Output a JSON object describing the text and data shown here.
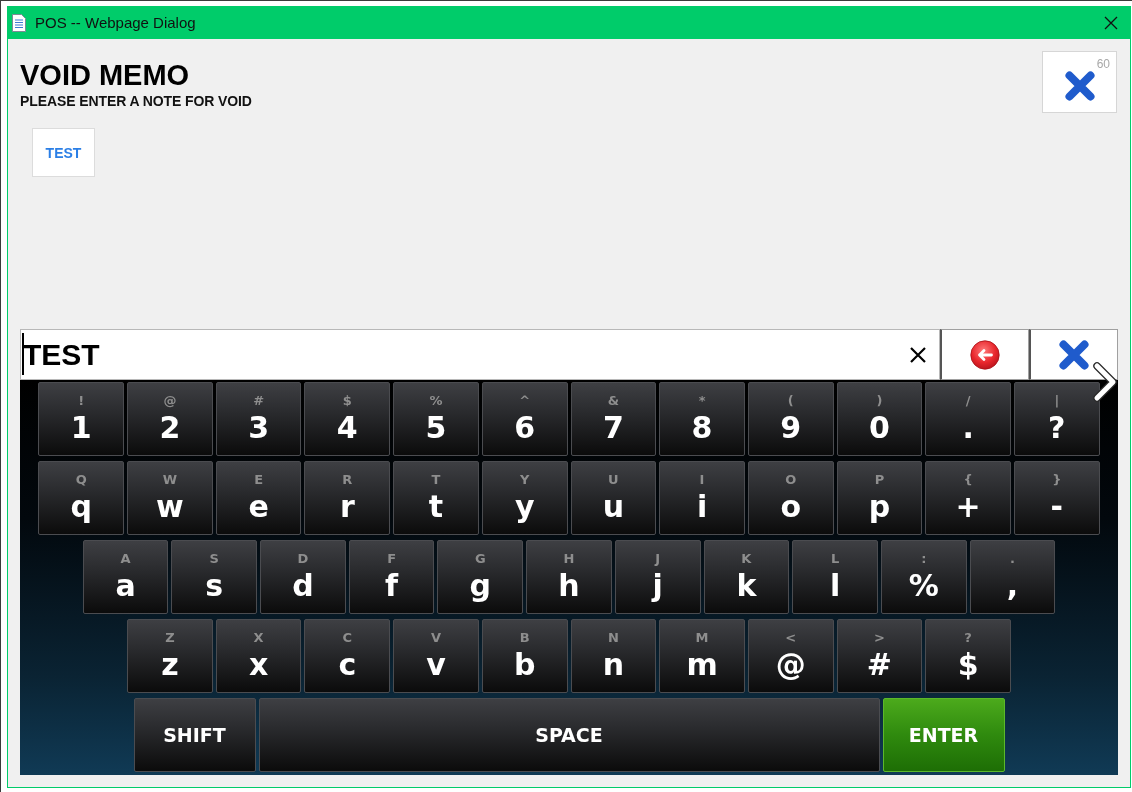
{
  "window": {
    "title": "POS -- Webpage Dialog"
  },
  "header": {
    "title": "VOID MEMO",
    "subtitle": "PLEASE ENTER A NOTE FOR VOID"
  },
  "close_button": {
    "countdown": "60"
  },
  "quick_notes": [
    {
      "label": "TEST"
    }
  ],
  "input": {
    "value": "TEST"
  },
  "keyboard": {
    "rows": [
      {
        "keys": [
          {
            "kind": "char",
            "shift": "!",
            "label": "1"
          },
          {
            "kind": "char",
            "shift": "@",
            "label": "2"
          },
          {
            "kind": "char",
            "shift": "#",
            "label": "3"
          },
          {
            "kind": "char",
            "shift": "$",
            "label": "4"
          },
          {
            "kind": "char",
            "shift": "%",
            "label": "5"
          },
          {
            "kind": "char",
            "shift": "^",
            "label": "6"
          },
          {
            "kind": "char",
            "shift": "&",
            "label": "7"
          },
          {
            "kind": "char",
            "shift": "*",
            "label": "8"
          },
          {
            "kind": "char",
            "shift": "(",
            "label": "9"
          },
          {
            "kind": "char",
            "shift": ")",
            "label": "0"
          },
          {
            "kind": "char",
            "shift": "/",
            "label": "."
          },
          {
            "kind": "char",
            "shift": "|",
            "label": "?"
          }
        ]
      },
      {
        "keys": [
          {
            "kind": "char",
            "shift": "Q",
            "label": "q"
          },
          {
            "kind": "char",
            "shift": "W",
            "label": "w"
          },
          {
            "kind": "char",
            "shift": "E",
            "label": "e"
          },
          {
            "kind": "char",
            "shift": "R",
            "label": "r"
          },
          {
            "kind": "char",
            "shift": "T",
            "label": "t"
          },
          {
            "kind": "char",
            "shift": "Y",
            "label": "y"
          },
          {
            "kind": "char",
            "shift": "U",
            "label": "u"
          },
          {
            "kind": "char",
            "shift": "I",
            "label": "i"
          },
          {
            "kind": "char",
            "shift": "O",
            "label": "o"
          },
          {
            "kind": "char",
            "shift": "P",
            "label": "p"
          },
          {
            "kind": "char",
            "shift": "{",
            "label": "+"
          },
          {
            "kind": "char",
            "shift": "}",
            "label": "-"
          }
        ]
      },
      {
        "keys": [
          {
            "kind": "char",
            "shift": "A",
            "label": "a"
          },
          {
            "kind": "char",
            "shift": "S",
            "label": "s"
          },
          {
            "kind": "char",
            "shift": "D",
            "label": "d"
          },
          {
            "kind": "char",
            "shift": "F",
            "label": "f"
          },
          {
            "kind": "char",
            "shift": "G",
            "label": "g"
          },
          {
            "kind": "char",
            "shift": "H",
            "label": "h"
          },
          {
            "kind": "char",
            "shift": "J",
            "label": "j"
          },
          {
            "kind": "char",
            "shift": "K",
            "label": "k"
          },
          {
            "kind": "char",
            "shift": "L",
            "label": "l"
          },
          {
            "kind": "char",
            "shift": ":",
            "label": "%"
          },
          {
            "kind": "char",
            "shift": ".",
            "label": ","
          }
        ]
      },
      {
        "keys": [
          {
            "kind": "char",
            "shift": "Z",
            "label": "z"
          },
          {
            "kind": "char",
            "shift": "X",
            "label": "x"
          },
          {
            "kind": "char",
            "shift": "C",
            "label": "c"
          },
          {
            "kind": "char",
            "shift": "V",
            "label": "v"
          },
          {
            "kind": "char",
            "shift": "B",
            "label": "b"
          },
          {
            "kind": "char",
            "shift": "N",
            "label": "n"
          },
          {
            "kind": "char",
            "shift": "M",
            "label": "m"
          },
          {
            "kind": "char",
            "shift": "<",
            "label": "@"
          },
          {
            "kind": "char",
            "shift": ">",
            "label": "#"
          },
          {
            "kind": "char",
            "shift": "?",
            "label": "$"
          }
        ]
      },
      {
        "keys": [
          {
            "kind": "shift",
            "label": "SHIFT"
          },
          {
            "kind": "space",
            "label": "SPACE"
          },
          {
            "kind": "enter",
            "label": "ENTER"
          }
        ]
      }
    ]
  }
}
